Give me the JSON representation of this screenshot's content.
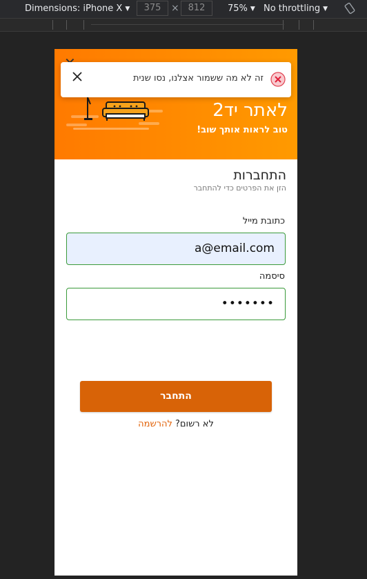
{
  "devtools": {
    "device": "Dimensions: iPhone X",
    "width": "375",
    "height": "812",
    "zoom": "75%",
    "throttle": "No throttling"
  },
  "hero": {
    "title": "לאתר יד2",
    "subtitle": "טוב לראות אותך שוב!"
  },
  "toast": {
    "message": "זה לא מה ששמור אצלנו, נסו שנית"
  },
  "form": {
    "heading": "התחברות",
    "subheading": "הזן את הפרטים כדי להתחבר",
    "email_label": "כתובת מייל",
    "email_value": "a@email.com",
    "password_label": "סיסמה",
    "password_value": "•••••••",
    "login_button": "התחבר",
    "not_registered": "לא רשום?",
    "register_link": "להרשמה"
  },
  "colors": {
    "accent": "#ff8c00",
    "button": "#d86307",
    "field_border": "#3a9a3a"
  }
}
